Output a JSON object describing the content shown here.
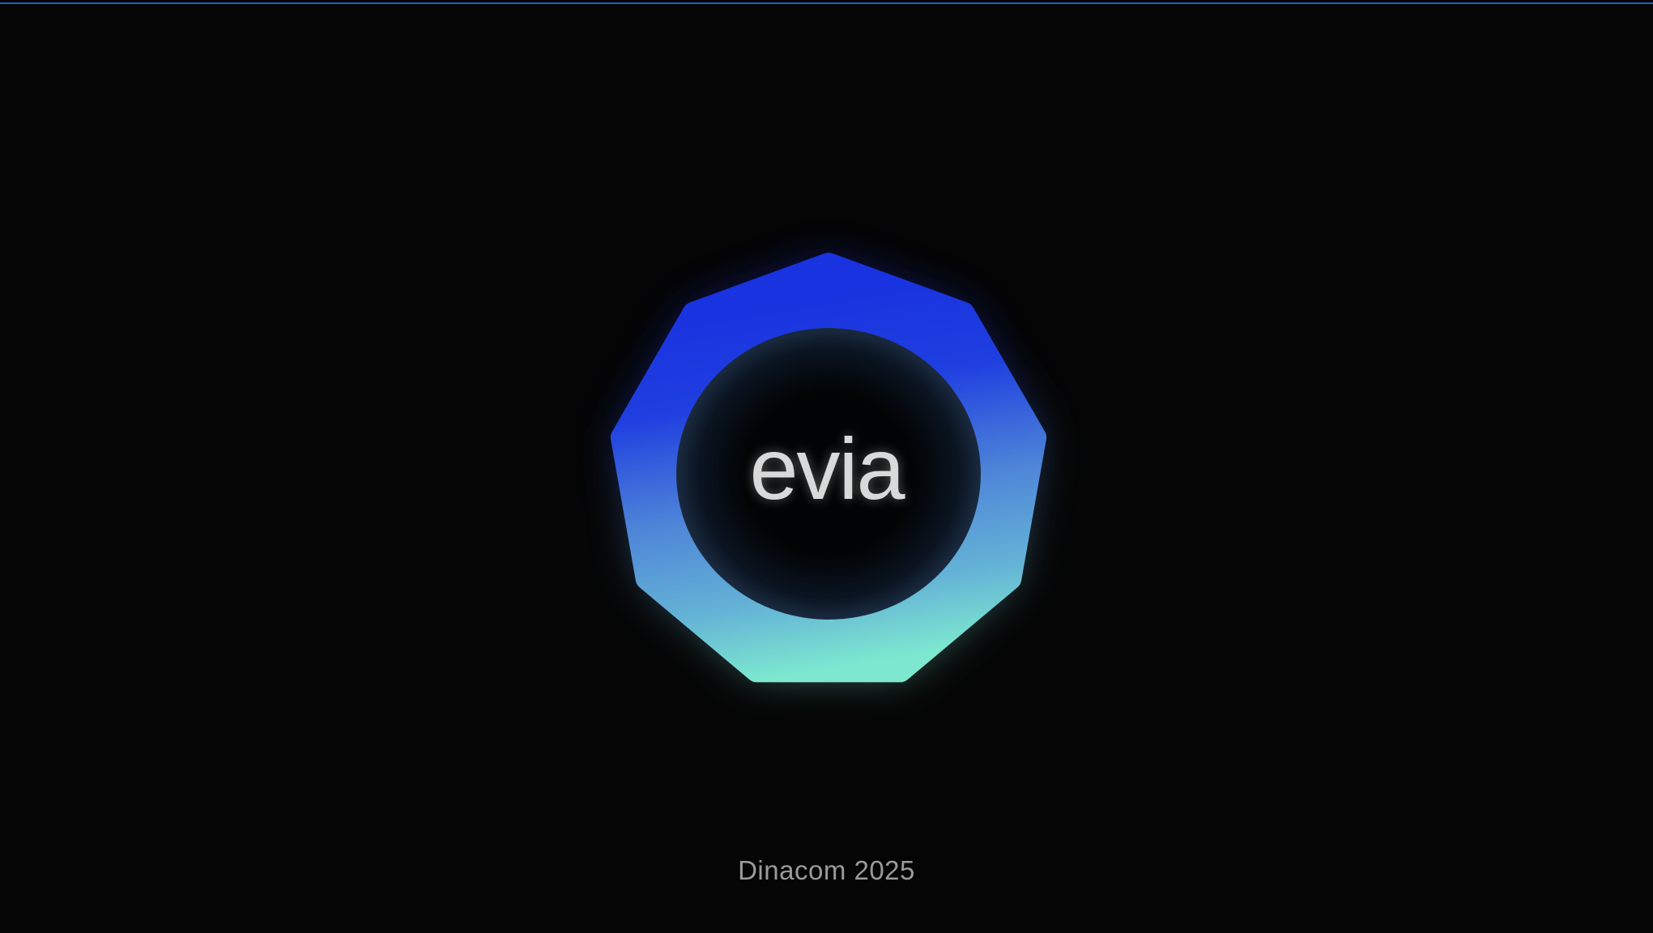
{
  "brand": {
    "wordmark": "evia",
    "logo_icon": "nonagon-ring-logo",
    "gradient_colors": [
      "#1a33e0",
      "#4f86d8",
      "#7de8cf"
    ]
  },
  "footer": {
    "event_label": "Dinacom 2025"
  },
  "theme": {
    "background": "#050505",
    "top_line": "#1f5fb8"
  }
}
